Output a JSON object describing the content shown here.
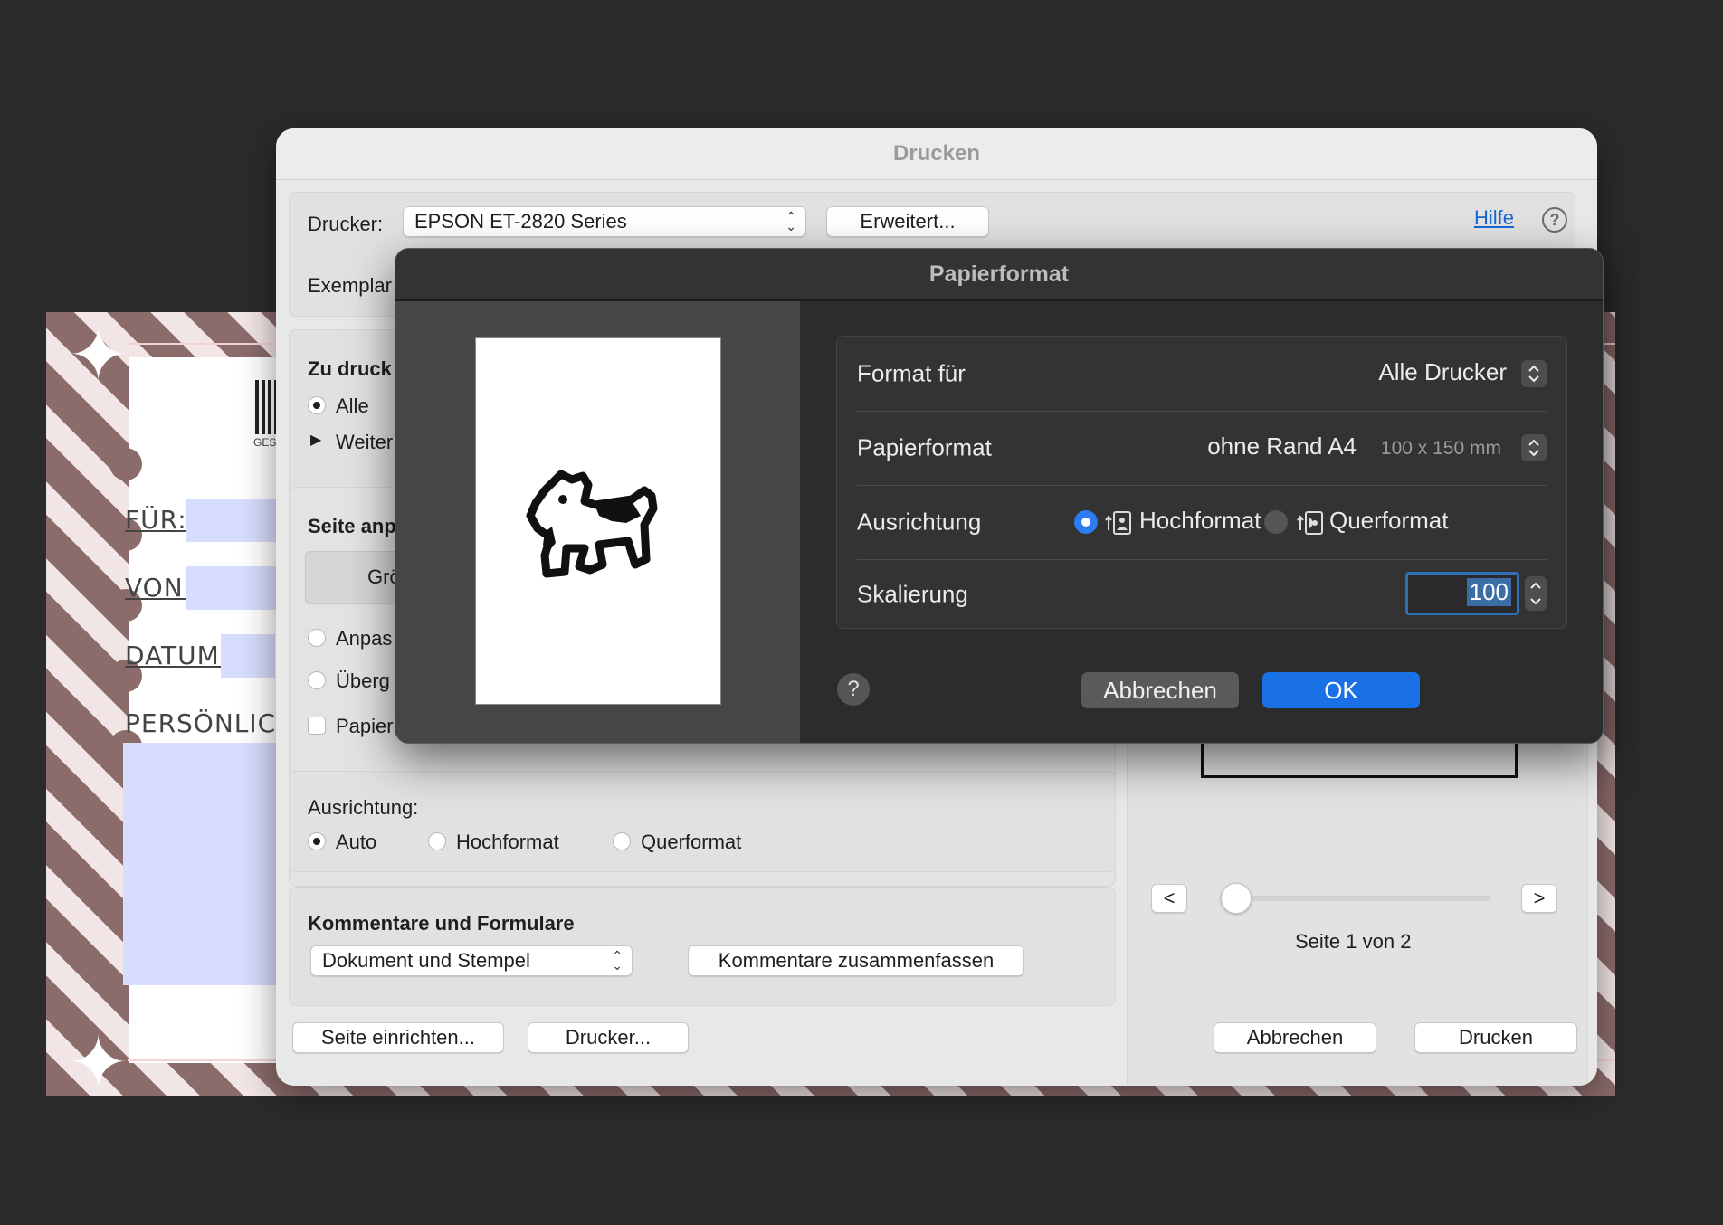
{
  "document": {
    "labels": [
      "FÜR:",
      "VON:",
      "DATUM:",
      "PERSÖNLICH"
    ],
    "barcode_caption": "GES"
  },
  "print_dialog": {
    "title": "Drucken",
    "printer_label": "Drucker:",
    "printer_value": "EPSON ET-2820 Series",
    "advanced_button": "Erweitert...",
    "help_link": "Hilfe",
    "copies_label": "Exemplar",
    "pages_section_title": "Zu druck",
    "pages_all": "Alle",
    "pages_more": "Weiter",
    "fit_section_title": "Seite anp",
    "fit_button": "Grö",
    "fit_option_1": "Anpas",
    "fit_option_2": "Überg",
    "fit_option_3": "Papier",
    "orientation_label": "Ausrichtung:",
    "orientation_options": [
      "Auto",
      "Hochformat",
      "Querformat"
    ],
    "orientation_selected": "Auto",
    "comments_title": "Kommentare und Formulare",
    "comments_select": "Dokument und Stempel",
    "comments_button": "Kommentare zusammenfassen",
    "page_nav_prev": "<",
    "page_nav_next": ">",
    "page_indicator": "Seite 1 von 2",
    "page_setup_button": "Seite einrichten...",
    "printer_button": "Drucker...",
    "cancel_button": "Abbrechen",
    "print_button": "Drucken"
  },
  "paper_dialog": {
    "title": "Papierformat",
    "format_for_label": "Format für",
    "format_for_value": "Alle Drucker",
    "paper_size_label": "Papierformat",
    "paper_size_value": "ohne Rand A4",
    "paper_size_dimensions": "100 x 150 mm",
    "orientation_label": "Ausrichtung",
    "orientation_portrait": "Hochformat",
    "orientation_landscape": "Querformat",
    "orientation_selected": "Hochformat",
    "scale_label": "Skalierung",
    "scale_value": "100",
    "help_button": "?",
    "cancel_button": "Abbrechen",
    "ok_button": "OK",
    "accent_color": "#1a71e6"
  }
}
